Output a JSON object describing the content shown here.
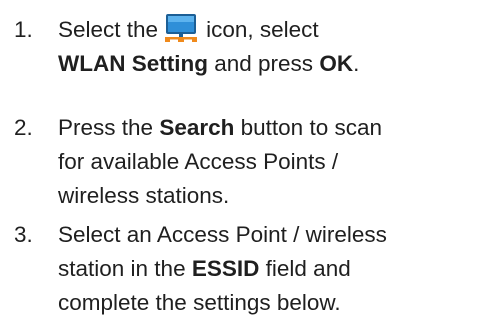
{
  "steps": [
    {
      "number": "1.",
      "text_a": "Select the",
      "icon": "network-monitor-icon",
      "text_b": "icon, select",
      "bold_a": "WLAN Setting",
      "text_c": "and press",
      "bold_b": "OK",
      "text_d": "."
    },
    {
      "number": "2.",
      "text_a": "Press the",
      "bold_a": "Search",
      "text_b": "button to scan",
      "line2": "for available Access Points /",
      "line3": "wireless stations."
    },
    {
      "number": "3.",
      "line1": "Select an Access Point / wireless",
      "text_a": "station in the",
      "bold_a": "ESSID",
      "text_b": "field and",
      "line3": "complete the settings below."
    }
  ],
  "colors": {
    "text": "#1f1f1f",
    "icon_screen": "#2f8fd8",
    "icon_frame": "#1c5f96",
    "icon_network": "#f08a1c"
  }
}
